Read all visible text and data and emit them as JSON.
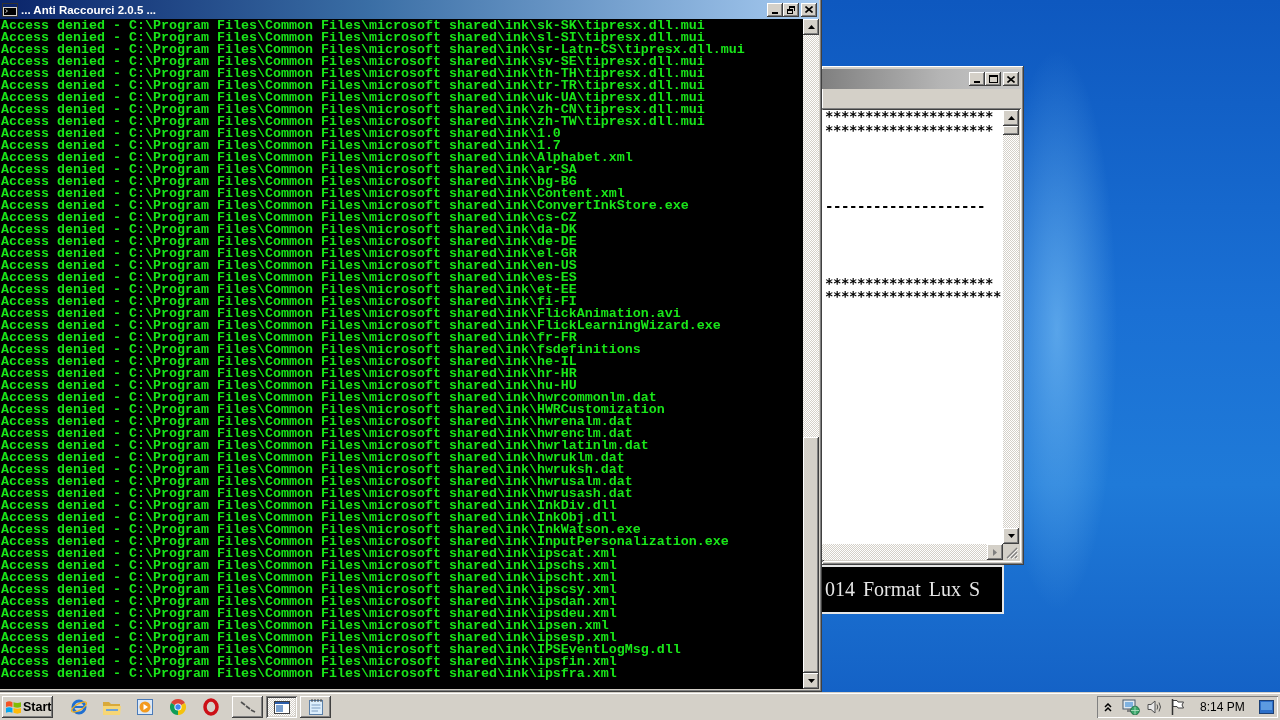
{
  "console_window": {
    "title": "... Anti Raccourci 2.0.5 ...",
    "active": true,
    "lines": [
      "Access denied - C:\\Program Files\\Common Files\\microsoft shared\\ink\\sk-SK\\tipresx.dll.mui",
      "Access denied - C:\\Program Files\\Common Files\\microsoft shared\\ink\\sl-SI\\tipresx.dll.mui",
      "Access denied - C:\\Program Files\\Common Files\\microsoft shared\\ink\\sr-Latn-CS\\tipresx.dll.mui",
      "Access denied - C:\\Program Files\\Common Files\\microsoft shared\\ink\\sv-SE\\tipresx.dll.mui",
      "Access denied - C:\\Program Files\\Common Files\\microsoft shared\\ink\\th-TH\\tipresx.dll.mui",
      "Access denied - C:\\Program Files\\Common Files\\microsoft shared\\ink\\tr-TR\\tipresx.dll.mui",
      "Access denied - C:\\Program Files\\Common Files\\microsoft shared\\ink\\uk-UA\\tipresx.dll.mui",
      "Access denied - C:\\Program Files\\Common Files\\microsoft shared\\ink\\zh-CN\\tipresx.dll.mui",
      "Access denied - C:\\Program Files\\Common Files\\microsoft shared\\ink\\zh-TW\\tipresx.dll.mui",
      "Access denied - C:\\Program Files\\Common Files\\microsoft shared\\ink\\1.0",
      "Access denied - C:\\Program Files\\Common Files\\microsoft shared\\ink\\1.7",
      "Access denied - C:\\Program Files\\Common Files\\microsoft shared\\ink\\Alphabet.xml",
      "Access denied - C:\\Program Files\\Common Files\\microsoft shared\\ink\\ar-SA",
      "Access denied - C:\\Program Files\\Common Files\\microsoft shared\\ink\\bg-BG",
      "Access denied - C:\\Program Files\\Common Files\\microsoft shared\\ink\\Content.xml",
      "Access denied - C:\\Program Files\\Common Files\\microsoft shared\\ink\\ConvertInkStore.exe",
      "Access denied - C:\\Program Files\\Common Files\\microsoft shared\\ink\\cs-CZ",
      "Access denied - C:\\Program Files\\Common Files\\microsoft shared\\ink\\da-DK",
      "Access denied - C:\\Program Files\\Common Files\\microsoft shared\\ink\\de-DE",
      "Access denied - C:\\Program Files\\Common Files\\microsoft shared\\ink\\el-GR",
      "Access denied - C:\\Program Files\\Common Files\\microsoft shared\\ink\\en-US",
      "Access denied - C:\\Program Files\\Common Files\\microsoft shared\\ink\\es-ES",
      "Access denied - C:\\Program Files\\Common Files\\microsoft shared\\ink\\et-EE",
      "Access denied - C:\\Program Files\\Common Files\\microsoft shared\\ink\\fi-FI",
      "Access denied - C:\\Program Files\\Common Files\\microsoft shared\\ink\\FlickAnimation.avi",
      "Access denied - C:\\Program Files\\Common Files\\microsoft shared\\ink\\FlickLearningWizard.exe",
      "Access denied - C:\\Program Files\\Common Files\\microsoft shared\\ink\\fr-FR",
      "Access denied - C:\\Program Files\\Common Files\\microsoft shared\\ink\\fsdefinitions",
      "Access denied - C:\\Program Files\\Common Files\\microsoft shared\\ink\\he-IL",
      "Access denied - C:\\Program Files\\Common Files\\microsoft shared\\ink\\hr-HR",
      "Access denied - C:\\Program Files\\Common Files\\microsoft shared\\ink\\hu-HU",
      "Access denied - C:\\Program Files\\Common Files\\microsoft shared\\ink\\hwrcommonlm.dat",
      "Access denied - C:\\Program Files\\Common Files\\microsoft shared\\ink\\HWRCustomization",
      "Access denied - C:\\Program Files\\Common Files\\microsoft shared\\ink\\hwrenalm.dat",
      "Access denied - C:\\Program Files\\Common Files\\microsoft shared\\ink\\hwrenclm.dat",
      "Access denied - C:\\Program Files\\Common Files\\microsoft shared\\ink\\hwrlatinlm.dat",
      "Access denied - C:\\Program Files\\Common Files\\microsoft shared\\ink\\hwruklm.dat",
      "Access denied - C:\\Program Files\\Common Files\\microsoft shared\\ink\\hwruksh.dat",
      "Access denied - C:\\Program Files\\Common Files\\microsoft shared\\ink\\hwrusalm.dat",
      "Access denied - C:\\Program Files\\Common Files\\microsoft shared\\ink\\hwrusash.dat",
      "Access denied - C:\\Program Files\\Common Files\\microsoft shared\\ink\\InkDiv.dll",
      "Access denied - C:\\Program Files\\Common Files\\microsoft shared\\ink\\InkObj.dll",
      "Access denied - C:\\Program Files\\Common Files\\microsoft shared\\ink\\InkWatson.exe",
      "Access denied - C:\\Program Files\\Common Files\\microsoft shared\\ink\\InputPersonalization.exe",
      "Access denied - C:\\Program Files\\Common Files\\microsoft shared\\ink\\ipscat.xml",
      "Access denied - C:\\Program Files\\Common Files\\microsoft shared\\ink\\ipschs.xml",
      "Access denied - C:\\Program Files\\Common Files\\microsoft shared\\ink\\ipscht.xml",
      "Access denied - C:\\Program Files\\Common Files\\microsoft shared\\ink\\ipscsy.xml",
      "Access denied - C:\\Program Files\\Common Files\\microsoft shared\\ink\\ipsdan.xml",
      "Access denied - C:\\Program Files\\Common Files\\microsoft shared\\ink\\ipsdeu.xml",
      "Access denied - C:\\Program Files\\Common Files\\microsoft shared\\ink\\ipsen.xml",
      "Access denied - C:\\Program Files\\Common Files\\microsoft shared\\ink\\ipsesp.xml",
      "Access denied - C:\\Program Files\\Common Files\\microsoft shared\\ink\\IPSEventLogMsg.dll",
      "Access denied - C:\\Program Files\\Common Files\\microsoft shared\\ink\\ipsfin.xml",
      "Access denied - C:\\Program Files\\Common Files\\microsoft shared\\ink\\ipsfra.xml"
    ]
  },
  "background_window": {
    "active": false,
    "text_blocks": [
      "*********************\n*********************",
      "--------------------",
      "*********************\n**********************"
    ]
  },
  "banner": {
    "text": "014 Format Lux S"
  },
  "taskbar": {
    "start_label": "Start",
    "tasks": [
      {
        "kind": "connector",
        "selected": false
      },
      {
        "kind": "window",
        "selected": true
      },
      {
        "kind": "notepad",
        "selected": false
      }
    ],
    "clock": "8:14 PM"
  }
}
